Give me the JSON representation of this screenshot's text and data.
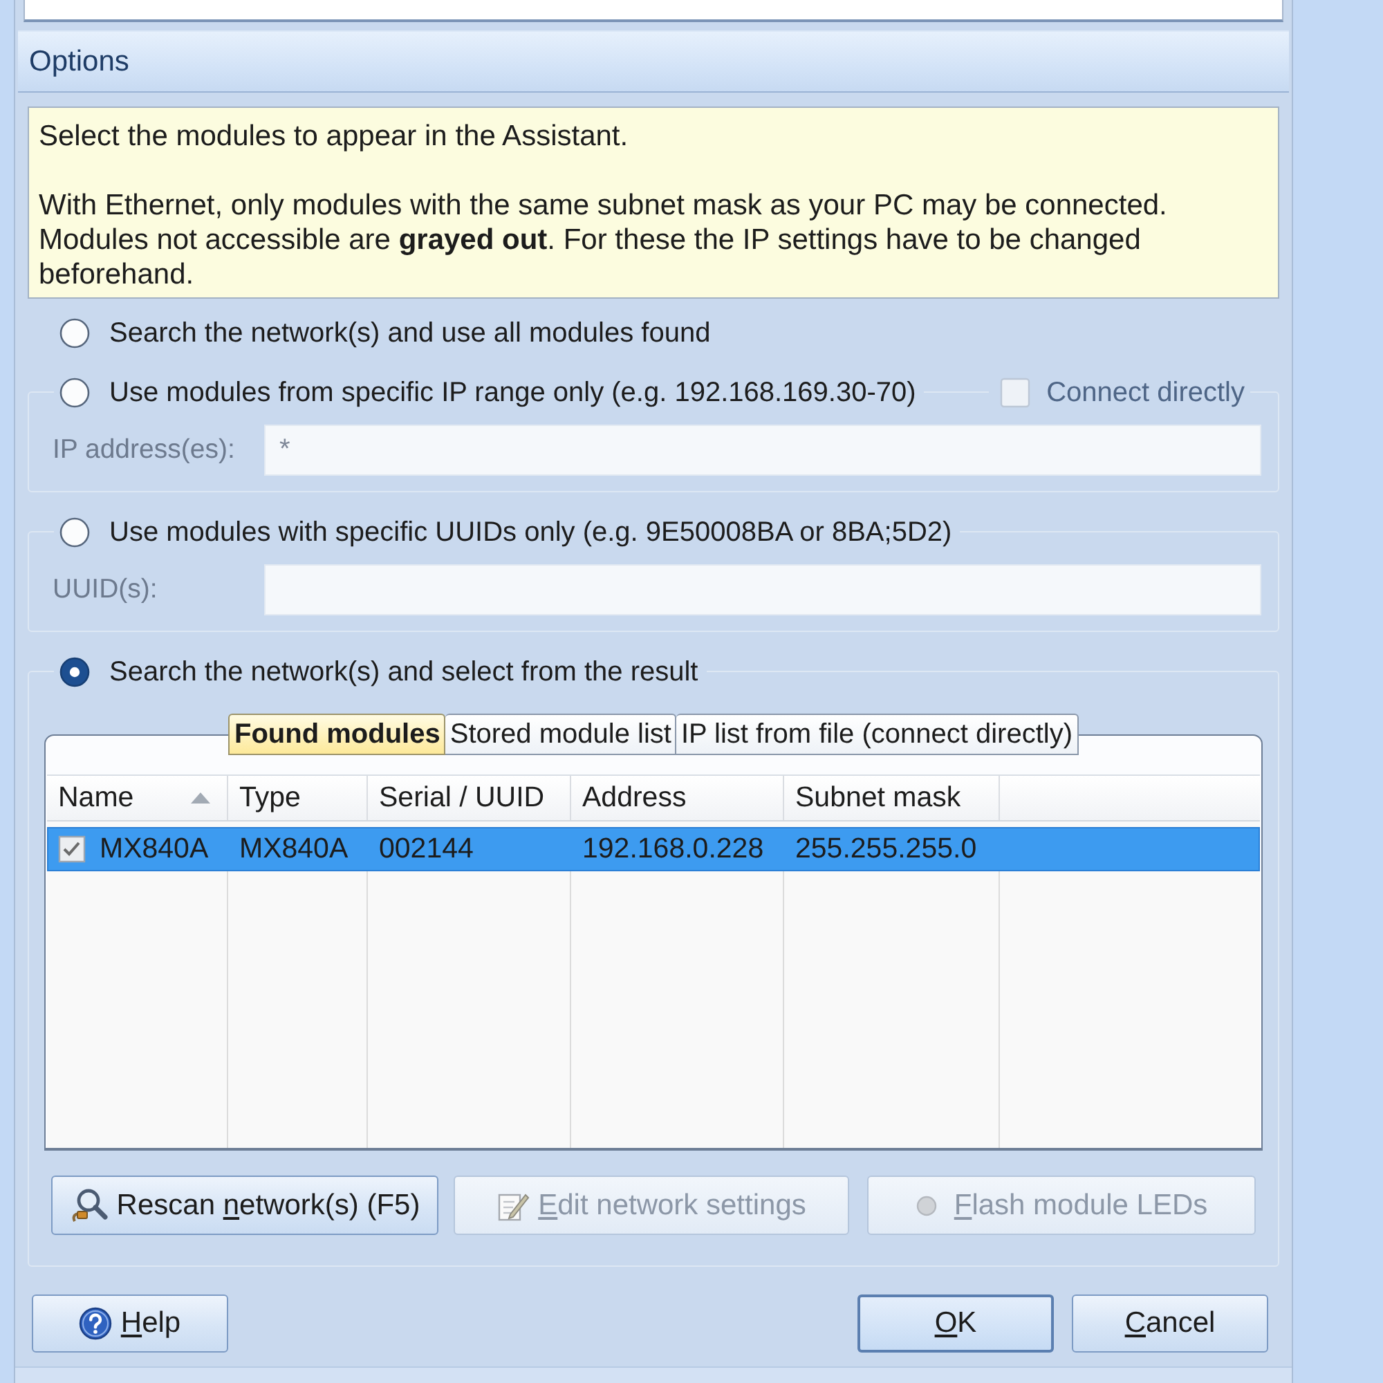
{
  "options_header": {
    "title": "Options"
  },
  "info": {
    "intro": "Select the modules to appear in the Assistant.",
    "lines": [
      "With Ethernet, only modules with the same subnet mask as your PC may be connected.",
      "Modules not accessible are **grayed out**. For these the IP settings have to be changed beforehand."
    ]
  },
  "choices": [
    {
      "kind": "plain",
      "label": "Search the network(s) and use all modules found",
      "selected": false
    },
    {
      "kind": "field",
      "label": "Use modules from specific IP range only (e.g. 192.168.169.30-70)",
      "selected": false,
      "checkbox": {
        "label": "Connect directly",
        "checked": false,
        "disabled": true
      },
      "field": {
        "label": "IP address(es):",
        "value": "*",
        "disabled": true
      }
    },
    {
      "kind": "field",
      "label": "Use modules with specific UUIDs only (e.g. 9E50008BA or 8BA;5D2)",
      "selected": false,
      "field": {
        "label": "UUID(s):",
        "disabled": true
      }
    },
    {
      "kind": "results",
      "label": "Search the network(s) and select from the result",
      "selected": true
    }
  ],
  "results": {
    "tabs": [
      {
        "label": "Found modules",
        "selected": true
      },
      {
        "label": "Stored module list",
        "selected": false
      },
      {
        "label": "IP list from file (connect directly)",
        "selected": false
      }
    ],
    "table": {
      "columns": [
        {
          "label": "Name",
          "sorted": true
        },
        {
          "label": "Type",
          "sorted": false
        },
        {
          "label": "Serial / UUID",
          "sorted": false
        },
        {
          "label": "Address",
          "sorted": false
        },
        {
          "label": "Subnet mask",
          "sorted": false
        }
      ],
      "rows": [
        {
          "selected": true,
          "checked": true,
          "cells": [
            "MX840A",
            "MX840A",
            "002144",
            "192.168.0.228",
            "255.255.255.0"
          ]
        }
      ]
    },
    "buttons": [
      {
        "before": "Rescan ",
        "key": "n",
        "after": "etwork(s) (F5)",
        "disabled": false
      },
      {
        "key": "E",
        "after": "dit network settings",
        "disabled": true
      },
      {
        "key": "F",
        "after": "lash module LEDs",
        "disabled": true
      }
    ]
  },
  "footer": {
    "left": [
      {
        "key": "H",
        "after": "elp",
        "disabled": false,
        "default": false
      }
    ],
    "right": [
      {
        "key": "O",
        "after": "K",
        "disabled": false,
        "default": true
      },
      {
        "key": "C",
        "after": "ancel",
        "disabled": false,
        "default": false
      }
    ]
  }
}
